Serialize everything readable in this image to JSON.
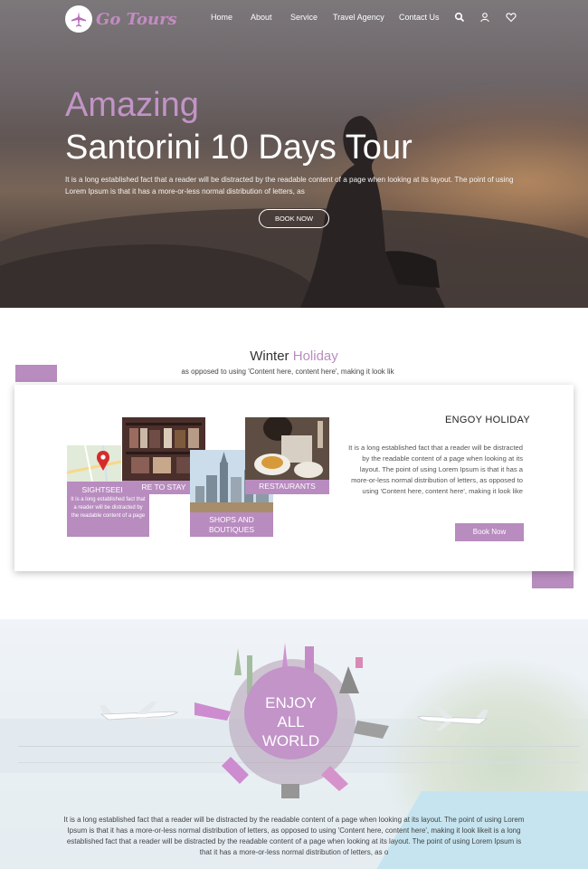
{
  "brand": {
    "logo_text": "Go Tours",
    "accent": "#b88cbf"
  },
  "nav": {
    "items": [
      {
        "label": "Home"
      },
      {
        "label": "About"
      },
      {
        "label": "Service"
      },
      {
        "label": "Travel Agency"
      },
      {
        "label": "Contact Us"
      }
    ],
    "icons": [
      "search-icon",
      "user-icon",
      "heart-icon"
    ]
  },
  "hero": {
    "eyebrow": "Amazing",
    "title": "Santorini 10 Days Tour",
    "description": "It is a long established fact that a reader will be distracted by the readable content of a page when looking at its layout. The point of using Lorem Ipsum is that it has a more-or-less normal distribution of letters, as",
    "button_label": "BOOK NOW"
  },
  "winter": {
    "title_plain": "Winter",
    "title_accent": "Holiday",
    "subtitle": "as opposed to using 'Content here, content here', making it look lik",
    "tiles": {
      "sightseeing": {
        "label": "SIGHTSEEING",
        "text": "It is a long established fact that a reader will be distracted by the readable content of a page"
      },
      "stay": {
        "label": "RE TO STAY"
      },
      "shops": {
        "label_line1": "SHOPS AND",
        "label_line2": "BOUTIQUES"
      },
      "restaurants": {
        "label": "RESTAURANTS"
      }
    },
    "panel": {
      "heading": "ENGOY HOLIDAY",
      "text": "It is a long established fact that a reader will be distracted by the readable content of a page when looking at its layout. The point of using Lorem Ipsum is that it has a more-or-less normal distribution of letters, as opposed to using 'Content here, content here', making it look like",
      "button_label": "Book Now"
    }
  },
  "world": {
    "badge_line1": "ENJOY",
    "badge_line2": "ALL",
    "badge_line3": "WORLD",
    "text": "It is a long established fact that a reader will be distracted by the readable content of a page when looking at its layout. The point of using Lorem Ipsum is that it has a more-or-less normal distribution of letters, as opposed to using 'Content here, content here', making it look likeit is a long established fact that a reader will be distracted by the readable content of a page when looking at its layout. The point of using Lorem Ipsum is that it has a more-or-less normal distribution of letters, as o"
  }
}
